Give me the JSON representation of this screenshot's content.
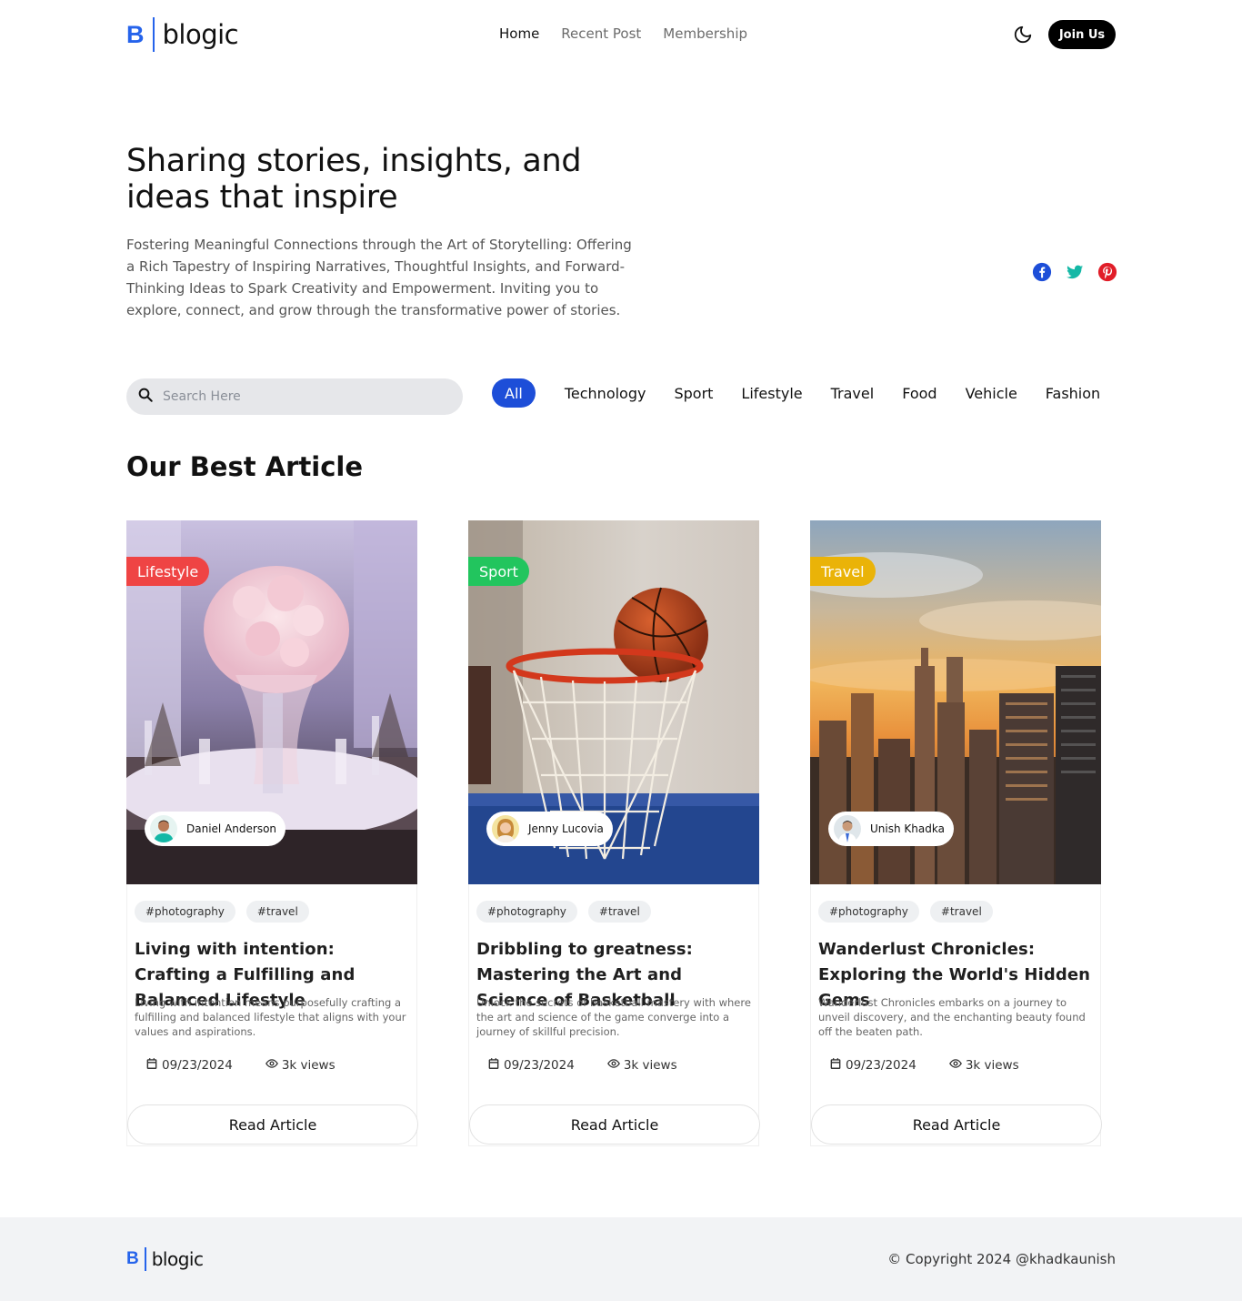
{
  "header": {
    "logo_letter": "B",
    "logo_text": "blogic",
    "nav": [
      "Home",
      "Recent Post",
      "Membership"
    ],
    "join_label": "Join Us"
  },
  "hero": {
    "title": "Sharing stories, insights, and ideas that inspire",
    "subtitle": "Fostering Meaningful Connections through the Art of Storytelling: Offering a Rich Tapestry of Inspiring Narratives, Thoughtful Insights, and Forward-Thinking Ideas to Spark Creativity and Empowerment. Inviting you to explore, connect, and grow through the transformative power of stories."
  },
  "social": [
    "facebook-icon",
    "twitter-icon",
    "pinterest-icon"
  ],
  "search": {
    "placeholder": "Search Here"
  },
  "filters": [
    "All",
    "Technology",
    "Sport",
    "Lifestyle",
    "Travel",
    "Food",
    "Vehicle",
    "Fashion"
  ],
  "section": {
    "title_plain": "Our ",
    "title_bold": "Best Article"
  },
  "articles": [
    {
      "category": "Lifestyle",
      "category_color": "#ef4444",
      "author": "Daniel Anderson",
      "tags": [
        "#photography",
        "#travel"
      ],
      "title": "Living with intention: Crafting a Fulfilling and Balanced Lifestyle",
      "description": "Living with intention means purposefully crafting a fulfilling and balanced lifestyle that aligns with your values and aspirations.",
      "date": "09/23/2024",
      "views": "3k views",
      "button": "Read Article"
    },
    {
      "category": "Sport",
      "category_color": "#22c55e",
      "author": "Jenny Lucovia",
      "tags": [
        "#photography",
        "#travel"
      ],
      "title": "Dribbling to greatness: Mastering the Art and Science of Basketball",
      "description": "Unlock the secrets of basketball mastery with where the art and science of the game converge into a journey of skillful precision.",
      "date": "09/23/2024",
      "views": "3k views",
      "button": "Read Article"
    },
    {
      "category": "Travel",
      "category_color": "#eab308",
      "author": "Unish Khadka",
      "tags": [
        "#photography",
        "#travel"
      ],
      "title": "Wanderlust Chronicles: Exploring the World's Hidden Gems",
      "description": "Wanderlust Chronicles embarks on a journey to unveil discovery, and the enchanting beauty found off the beaten path.",
      "date": "09/23/2024",
      "views": "3k views",
      "button": "Read Article"
    }
  ],
  "footer": {
    "logo_letter": "B",
    "logo_text": "blogic",
    "copyright": "© Copyright 2024 @khadkaunish"
  },
  "colors": {
    "accent": "#2563eb",
    "filter_active": "#1d4ed8"
  }
}
